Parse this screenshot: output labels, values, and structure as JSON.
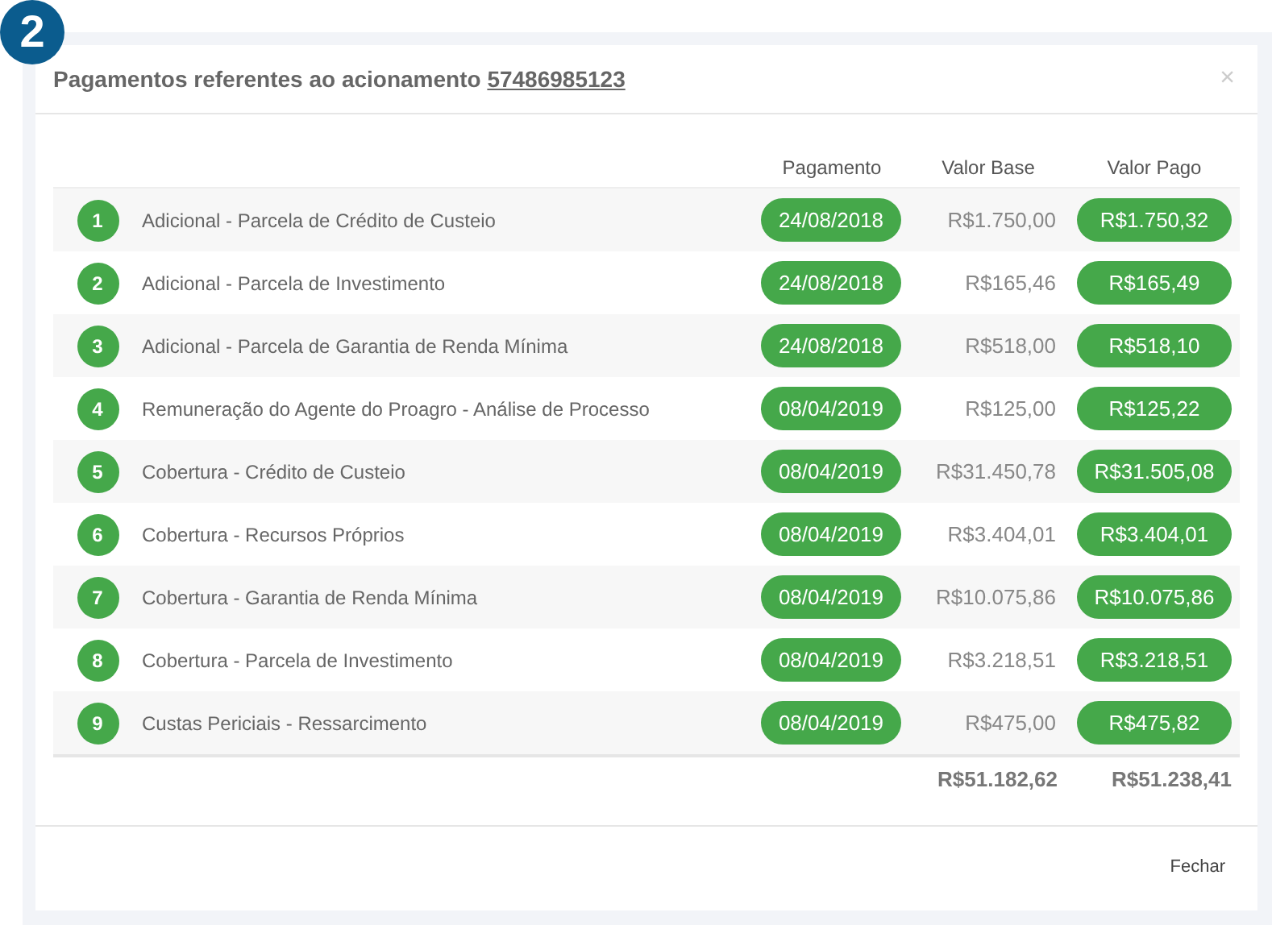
{
  "step_badge": "2",
  "modal": {
    "title": "Pagamentos referentes ao acionamento",
    "reference": "57486985123",
    "close": "×"
  },
  "table": {
    "columns": [
      "Pagamento",
      "Valor Base",
      "Valor Pago"
    ],
    "rows": [
      {
        "number": "1",
        "description": "Adicional - Parcela de Crédito de Custeio",
        "payment_date": "24/08/2018",
        "base_value": "R$1.750,00",
        "paid_value": "R$1.750,32"
      },
      {
        "number": "2",
        "description": "Adicional - Parcela de Investimento",
        "payment_date": "24/08/2018",
        "base_value": "R$165,46",
        "paid_value": "R$165,49"
      },
      {
        "number": "3",
        "description": "Adicional - Parcela de Garantia de Renda Mínima",
        "payment_date": "24/08/2018",
        "base_value": "R$518,00",
        "paid_value": "R$518,10"
      },
      {
        "number": "4",
        "description": "Remuneração do Agente do Proagro - Análise de Processo",
        "payment_date": "08/04/2019",
        "base_value": "R$125,00",
        "paid_value": "R$125,22"
      },
      {
        "number": "5",
        "description": "Cobertura - Crédito de Custeio",
        "payment_date": "08/04/2019",
        "base_value": "R$31.450,78",
        "paid_value": "R$31.505,08"
      },
      {
        "number": "6",
        "description": "Cobertura - Recursos Próprios",
        "payment_date": "08/04/2019",
        "base_value": "R$3.404,01",
        "paid_value": "R$3.404,01"
      },
      {
        "number": "7",
        "description": "Cobertura - Garantia de Renda Mínima",
        "payment_date": "08/04/2019",
        "base_value": "R$10.075,86",
        "paid_value": "R$10.075,86"
      },
      {
        "number": "8",
        "description": "Cobertura - Parcela de Investimento",
        "payment_date": "08/04/2019",
        "base_value": "R$3.218,51",
        "paid_value": "R$3.218,51"
      },
      {
        "number": "9",
        "description": "Custas Periciais - Ressarcimento",
        "payment_date": "08/04/2019",
        "base_value": "R$475,00",
        "paid_value": "R$475,82"
      }
    ],
    "totals": {
      "base_value": "R$51.182,62",
      "paid_value": "R$51.238,41"
    }
  },
  "footer": {
    "close_button": "Fechar"
  }
}
